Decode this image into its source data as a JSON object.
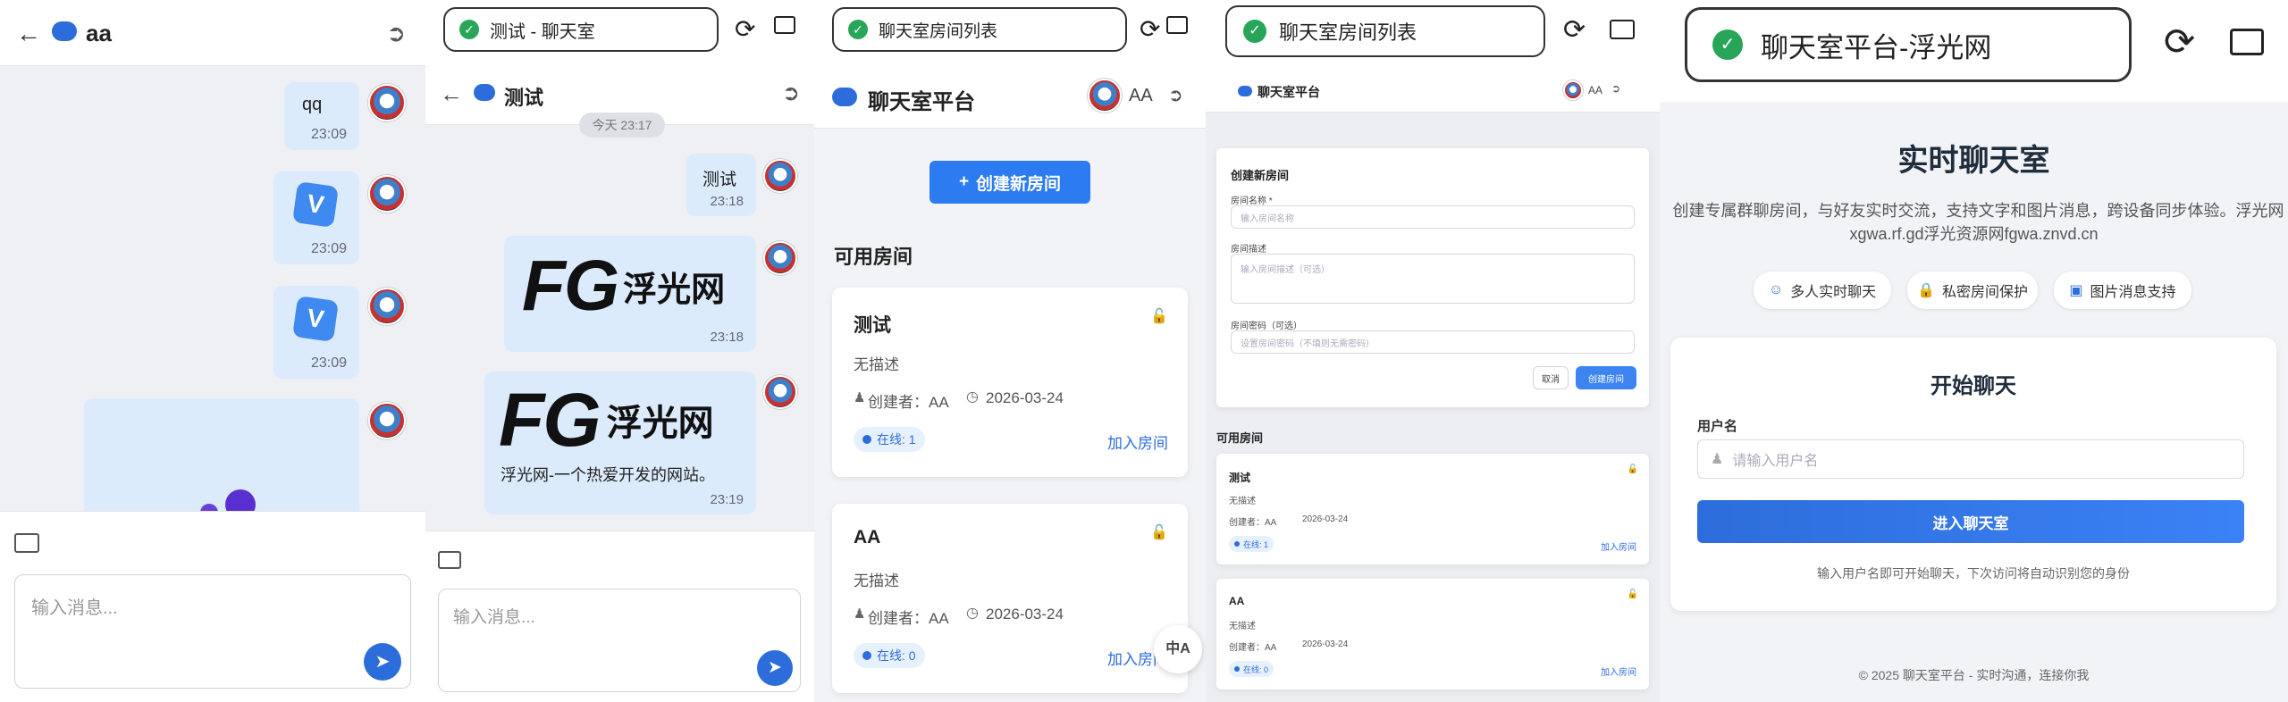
{
  "panel1": {
    "header_title": "aa",
    "messages": [
      {
        "text": "qq",
        "time": "23:09"
      },
      {
        "time": "23:09"
      },
      {
        "time": "23:09"
      }
    ],
    "input_placeholder": "输入消息..."
  },
  "panel2": {
    "url": "测试 - 聊天室",
    "header_title": "测试",
    "date_chip": "今天 23:17",
    "messages": [
      {
        "text": "测试",
        "time": "23:18"
      },
      {
        "logo": "FG",
        "brand": "浮光网",
        "time": "23:18"
      },
      {
        "logo": "FG",
        "brand": "浮光网",
        "caption": "浮光网-一个热爱开发的网站。",
        "time": "23:19"
      }
    ],
    "input_placeholder": "输入消息..."
  },
  "panel3": {
    "url": "聊天室房间列表",
    "brand": "聊天室平台",
    "user": "AA",
    "create_button": "创建新房间",
    "section_title": "可用房间",
    "rooms": [
      {
        "name": "测试",
        "desc": "无描述",
        "creator": "创建者：AA",
        "date": "2026-03-24",
        "online": "在线: 1",
        "join": "加入房间"
      },
      {
        "name": "AA",
        "desc": "无描述",
        "creator": "创建者：AA",
        "date": "2026-03-24",
        "online": "在线: 0",
        "join": "加入房间"
      }
    ],
    "translate_icon": "中A"
  },
  "panel4": {
    "url": "聊天室房间列表",
    "brand": "聊天室平台",
    "user": "AA",
    "form_title": "创建新房间",
    "name_label": "房间名称 *",
    "name_placeholder": "输入房间名称",
    "desc_label": "房间描述",
    "desc_placeholder": "输入房间描述（可选）",
    "pwd_label": "房间密码（可选）",
    "pwd_placeholder": "设置房间密码（不填则无需密码）",
    "cancel": "取消",
    "create": "创建房间",
    "section_title": "可用房间",
    "rooms": [
      {
        "name": "测试",
        "desc": "无描述",
        "creator": "创建者：AA",
        "date": "2026-03-24",
        "online": "在线: 1",
        "join": "加入房间"
      },
      {
        "name": "AA",
        "desc": "无描述",
        "creator": "创建者：AA",
        "date": "2026-03-24",
        "online": "在线: 0",
        "join": "加入房间"
      }
    ]
  },
  "panel5": {
    "url": "聊天室平台-浮光网",
    "title": "实时聊天室",
    "subtitle1": "创建专属群聊房间，与好友实时交流，支持文字和图片消息，跨设备同步体验。浮光网",
    "subtitle2": "xgwa.rf.gd浮光资源网fgwa.znvd.cn",
    "features": [
      "多人实时聊天",
      "私密房间保护",
      "图片消息支持"
    ],
    "card_title": "开始聊天",
    "username_label": "用户名",
    "username_placeholder": "请输入用户名",
    "enter_button": "进入聊天室",
    "hint": "输入用户名即可开始聊天，下次访问将自动识别您的身份",
    "footer": "© 2025 聊天室平台 - 实时沟通，连接你我"
  },
  "colors": {
    "accent": "#2d6ddb",
    "bubble": "#dcebfb",
    "shield": "#29a55a"
  }
}
